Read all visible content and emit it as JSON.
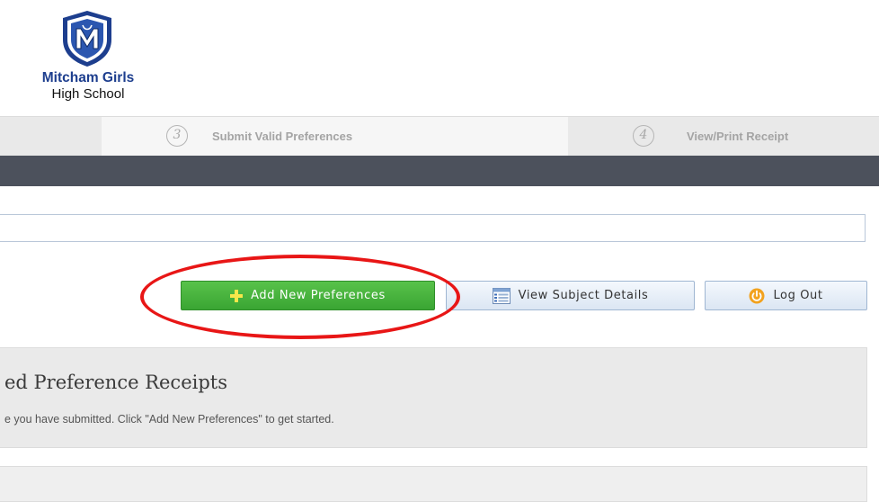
{
  "logo": {
    "name_line1": "Mitcham Girls",
    "name_line2": "High School",
    "crest_icon": "school-crest-icon",
    "brand_color": "#1d3e8e"
  },
  "steps": [
    {
      "number": "3",
      "label": "Submit Valid Preferences"
    },
    {
      "number": "4",
      "label": "View/Print Receipt"
    }
  ],
  "actions": {
    "add_label": "Add New Preferences",
    "add_icon": "plus-icon",
    "view_label": "View Subject Details",
    "view_icon": "list-document-icon",
    "logout_label": "Log Out",
    "logout_icon": "power-icon"
  },
  "receipts": {
    "title": "ed Preference Receipts",
    "subtitle": "e you have submitted. Click \"Add New Preferences\" to get started."
  },
  "colors": {
    "primary_green": "#3aa533",
    "dark_bar": "#4c515c",
    "highlight": "#e81616"
  }
}
